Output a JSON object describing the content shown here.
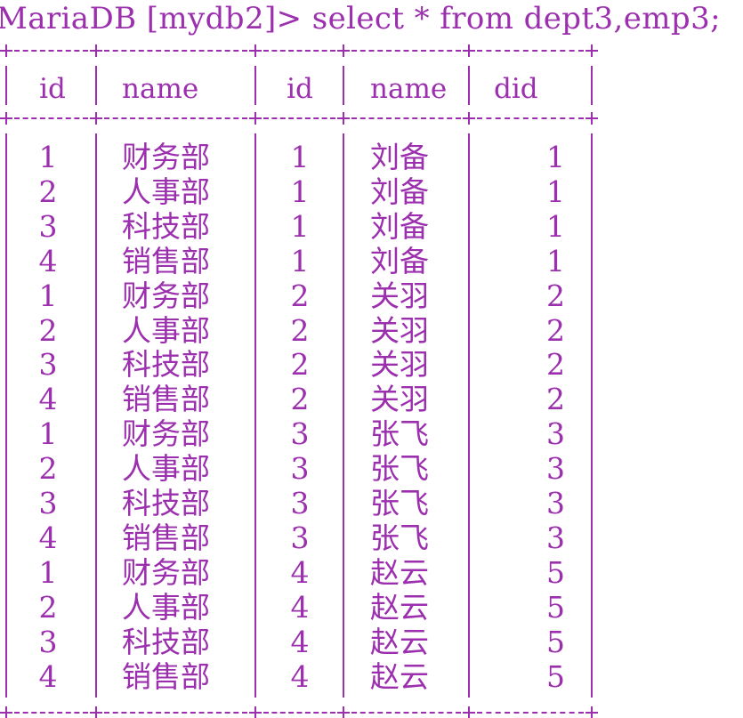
{
  "command_line": "MariaDB [mydb2]> select * from dept3,emp3;",
  "columns": [
    "id",
    "name",
    "id",
    "name",
    "did"
  ],
  "rows": [
    [
      "1",
      "财务部",
      "1",
      "刘备",
      "1"
    ],
    [
      "2",
      "人事部",
      "1",
      "刘备",
      "1"
    ],
    [
      "3",
      "科技部",
      "1",
      "刘备",
      "1"
    ],
    [
      "4",
      "销售部",
      "1",
      "刘备",
      "1"
    ],
    [
      "1",
      "财务部",
      "2",
      "关羽",
      "2"
    ],
    [
      "2",
      "人事部",
      "2",
      "关羽",
      "2"
    ],
    [
      "3",
      "科技部",
      "2",
      "关羽",
      "2"
    ],
    [
      "4",
      "销售部",
      "2",
      "关羽",
      "2"
    ],
    [
      "1",
      "财务部",
      "3",
      "张飞",
      "3"
    ],
    [
      "2",
      "人事部",
      "3",
      "张飞",
      "3"
    ],
    [
      "3",
      "科技部",
      "3",
      "张飞",
      "3"
    ],
    [
      "4",
      "销售部",
      "3",
      "张飞",
      "3"
    ],
    [
      "1",
      "财务部",
      "4",
      "赵云",
      "5"
    ],
    [
      "2",
      "人事部",
      "4",
      "赵云",
      "5"
    ],
    [
      "3",
      "科技部",
      "4",
      "赵云",
      "5"
    ],
    [
      "4",
      "销售部",
      "4",
      "赵云",
      "5"
    ]
  ],
  "colors": {
    "text": "#9b2fae",
    "background": "#ffffff"
  }
}
